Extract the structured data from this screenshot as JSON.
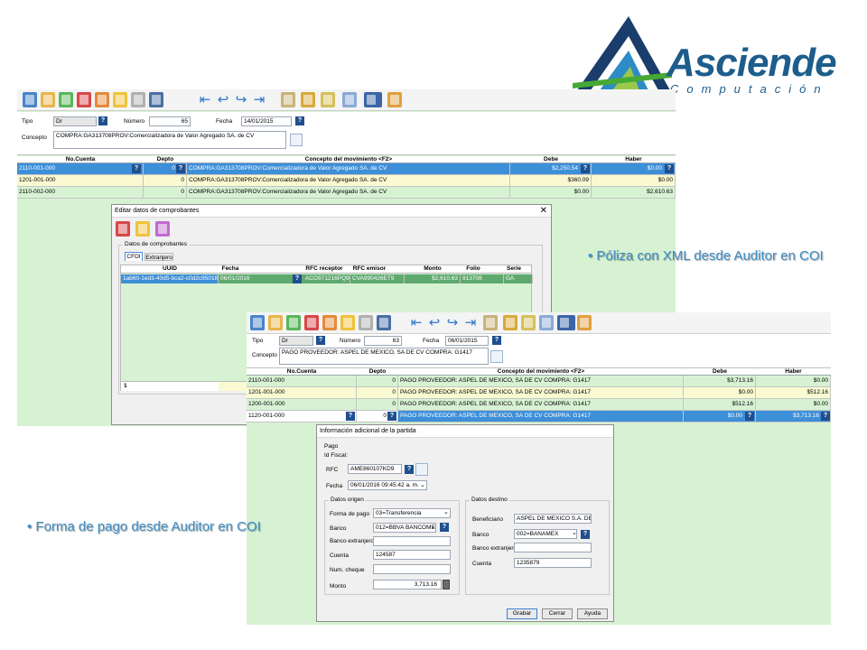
{
  "brand": {
    "name": "Asciende",
    "sub": "Computación",
    "color": "#1d5d8c"
  },
  "bullets": {
    "poliza": "Póliza con XML desde Auditor en COI",
    "pago": "Forma de pago desde  Auditor en COI"
  },
  "win1": {
    "labels": {
      "tipo": "Tipo",
      "numero": "Número",
      "fecha": "Fecha",
      "concepto": "Concepto"
    },
    "tipo": "Dr",
    "numero": "65",
    "fecha": "14/01/2015",
    "concepto": "COMPRA:GA313708PROV:Comercializadora de Valor Agregado SA. de CV",
    "columns": [
      "No.Cuenta",
      "Depto",
      "Concepto del movimiento <F2>",
      "Debe",
      "Haber"
    ],
    "rows": [
      {
        "cuenta": "2110-001-000",
        "depto": "0",
        "concepto": "COMPRA:GA313708PROV:Comercializadora de Valor Agregado SA. de CV",
        "debe": "$2,250.54",
        "haber": "$0.00"
      },
      {
        "cuenta": "1201-001-000",
        "depto": "0",
        "concepto": "COMPRA:GA313708PROV:Comercializadora de Valor Agregado SA. de CV",
        "debe": "$360.09",
        "haber": "$0.00"
      },
      {
        "cuenta": "2110-002-000",
        "depto": "0",
        "concepto": "COMPRA:GA313708PROV:Comercializadora de Valor Agregado SA. de CV",
        "debe": "$0.00",
        "haber": "$2,610.63"
      }
    ]
  },
  "dlg1": {
    "title": "Editar datos de comprobantes",
    "group": "Datos de comprobantes",
    "tabs": [
      "CFDI",
      "Extranjero"
    ],
    "columns": [
      "UUID",
      "Fecha",
      "RFC receptor",
      "RFC emisor",
      "Monto",
      "Folio",
      "Serie"
    ],
    "row": {
      "uuid": "1ab60-1ed3-40d5-bca2-c0d2c950188c",
      "fecha": "06/01/2016",
      "rfc_receptor": "ACO971216PQ9",
      "rfc_emisor": "CVA990426ET9",
      "monto": "$2,610.63",
      "folio": "913708",
      "serie": "GA"
    },
    "footer_count": "1"
  },
  "win2": {
    "labels": {
      "tipo": "Tipo",
      "numero": "Número",
      "fecha": "Fecha",
      "concepto": "Concepto"
    },
    "tipo": "Dr",
    "numero": "63",
    "fecha": "06/01/2015",
    "concepto": "PAGO PROVEEDOR: ASPEL DE MEXICO, SA DE CV COMPRA: G1417",
    "columns": [
      "No.Cuenta",
      "Depto",
      "Concepto del movimiento <F2>",
      "Debe",
      "Haber"
    ],
    "rows": [
      {
        "cuenta": "2110-001-000",
        "depto": "0",
        "concepto": "PAGO PROVEEDOR: ASPEL DE MEXICO, SA DE CV COMPRA: G1417",
        "debe": "$3,713.16",
        "haber": "$0.00"
      },
      {
        "cuenta": "1201-001-000",
        "depto": "0",
        "concepto": "PAGO PROVEEDOR: ASPEL DE MEXICO, SA DE CV COMPRA: G1417",
        "debe": "$0.00",
        "haber": "$512.16"
      },
      {
        "cuenta": "1200-001-000",
        "depto": "0",
        "concepto": "PAGO PROVEEDOR: ASPEL DE MEXICO, SA DE CV COMPRA: G1417",
        "debe": "$512.16",
        "haber": "$0.00"
      },
      {
        "cuenta": "1120-001-000",
        "depto": "0",
        "concepto": "PAGO PROVEEDOR: ASPEL DE MEXICO, SA DE CV COMPRA: G1417",
        "debe": "$0.00",
        "haber": "$3,713.16"
      }
    ]
  },
  "dlg2": {
    "title": "Información adicional de la partida",
    "pago": "Pago",
    "idfiscal": "Id Fiscal:",
    "rfc_label": "RFC",
    "rfc": "AME860107KD9",
    "fecha_label": "Fecha",
    "fecha": "06/01/2016 09:45:42 a. m.",
    "origen": {
      "title": "Datos origen",
      "forma_label": "Forma de pago",
      "forma": "03=Transferencia",
      "banco_label": "Banco",
      "banco": "012=BBVA BANCOMER",
      "banco_ext_label": "Banco extranjero",
      "banco_ext": "",
      "cuenta_label": "Cuenta",
      "cuenta": "124587",
      "cheque_label": "Num. cheque",
      "cheque": "",
      "monto_label": "Monto",
      "monto": "3,713.16"
    },
    "destino": {
      "title": "Datos destino",
      "beneficiario_label": "Beneficiario",
      "beneficiario": "ASPEL DE MEXICO S.A. DE C.V.",
      "banco_label": "Banco",
      "banco": "002=BANAMEX",
      "banco_ext_label": "Banco extranjero",
      "banco_ext": "",
      "cuenta_label": "Cuenta",
      "cuenta": "1235879"
    },
    "buttons": {
      "grabar": "Grabar",
      "cerrar": "Cerrar",
      "ayuda": "Ayuda"
    }
  },
  "colors": {
    "green_bg": "#d7f2d3",
    "selected": "#3d8fd8",
    "bullet": "#3f8fc8"
  }
}
